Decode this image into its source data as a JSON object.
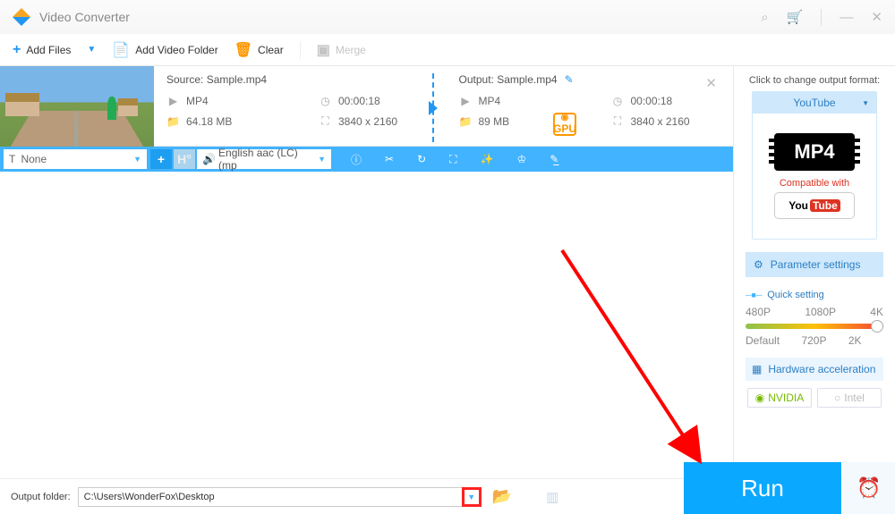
{
  "app_title": "Video Converter",
  "toolbar": {
    "add_files": "Add Files",
    "add_folder": "Add Video Folder",
    "clear": "Clear",
    "merge": "Merge"
  },
  "item": {
    "source_label": "Source: Sample.mp4",
    "output_label": "Output: Sample.mp4",
    "gpu": "GPU",
    "src": {
      "format": "MP4",
      "duration": "00:00:18",
      "size": "64.18 MB",
      "resolution": "3840 x 2160"
    },
    "out": {
      "format": "MP4",
      "duration": "00:00:18",
      "size": "89 MB",
      "resolution": "3840 x 2160"
    }
  },
  "action": {
    "subtitle": "None",
    "audio": "English aac (LC) (mp"
  },
  "right": {
    "change_format": "Click to change output format:",
    "profile": "YouTube",
    "badge": "MP4",
    "compatible": "Compatible with",
    "youtube_a": "You",
    "youtube_b": "Tube",
    "param": "Parameter settings",
    "quick": "Quick setting",
    "ticks_top": [
      "480P",
      "1080P",
      "4K"
    ],
    "ticks_bot": [
      "Default",
      "720P",
      "2K",
      ""
    ],
    "hw": "Hardware acceleration",
    "nvidia": "NVIDIA",
    "intel": "Intel"
  },
  "footer": {
    "label": "Output folder:",
    "path": "C:\\Users\\WonderFox\\Desktop",
    "run": "Run"
  }
}
